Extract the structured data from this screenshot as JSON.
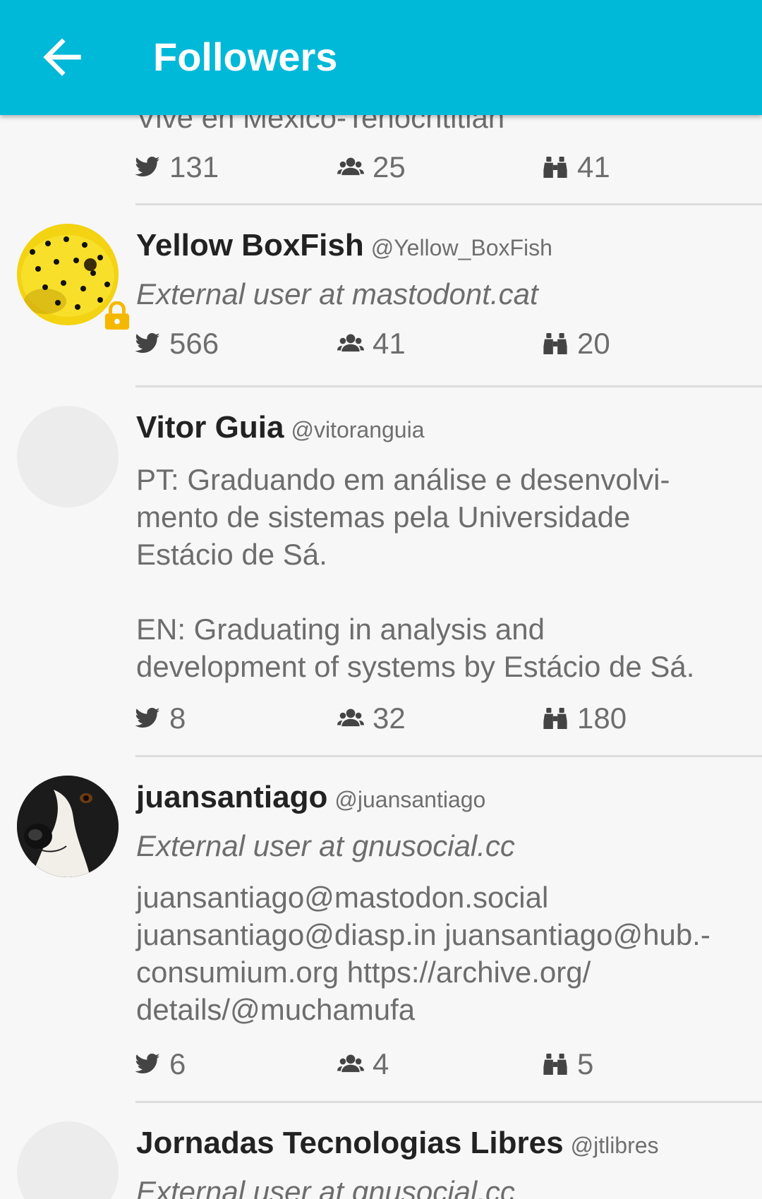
{
  "appbar": {
    "title": "Followers"
  },
  "icons": {
    "back": "arrow-left-icon",
    "statuses": "twitter-bird-icon",
    "followers": "users-group-icon",
    "following": "binoculars-icon",
    "locked": "lock-icon"
  },
  "colors": {
    "appbar": "#00b8d8",
    "lock": "#f5b800"
  },
  "partial_top": {
    "bio": "Vive en México-Tenochtitlan",
    "statuses": "131",
    "followers": "25",
    "following": "41"
  },
  "followers": [
    {
      "name": "Yellow BoxFish",
      "handle": "@Yellow_BoxFish",
      "note": "External user at mastodont.cat",
      "locked": true,
      "statuses": "566",
      "followers": "41",
      "following": "20"
    },
    {
      "name": "Vitor Guia",
      "handle": "@vitoranguia",
      "bio": "PT: Graduando em análise e desenvolvi-\nmento de sistemas pela Universidade\nEstácio de Sá.\n\nEN: Graduating in analysis and\ndevelopment of systems by Estácio de Sá.",
      "statuses": "8",
      "followers": "32",
      "following": "180"
    },
    {
      "name": "juansantiago",
      "handle": "@juansantiago",
      "note": "External user at gnusocial.cc",
      "bio": "juansantiago@mastodon.social\njuansantiago@diasp.in juansantiago@hub.-\nconsumium.org https://archive.org/\ndetails/@muchamufa",
      "statuses": "6",
      "followers": "4",
      "following": "5"
    },
    {
      "name": "Jornadas Tecnologias Libres",
      "handle": "@jtlibres",
      "note": "External user at gnusocial.cc"
    }
  ]
}
